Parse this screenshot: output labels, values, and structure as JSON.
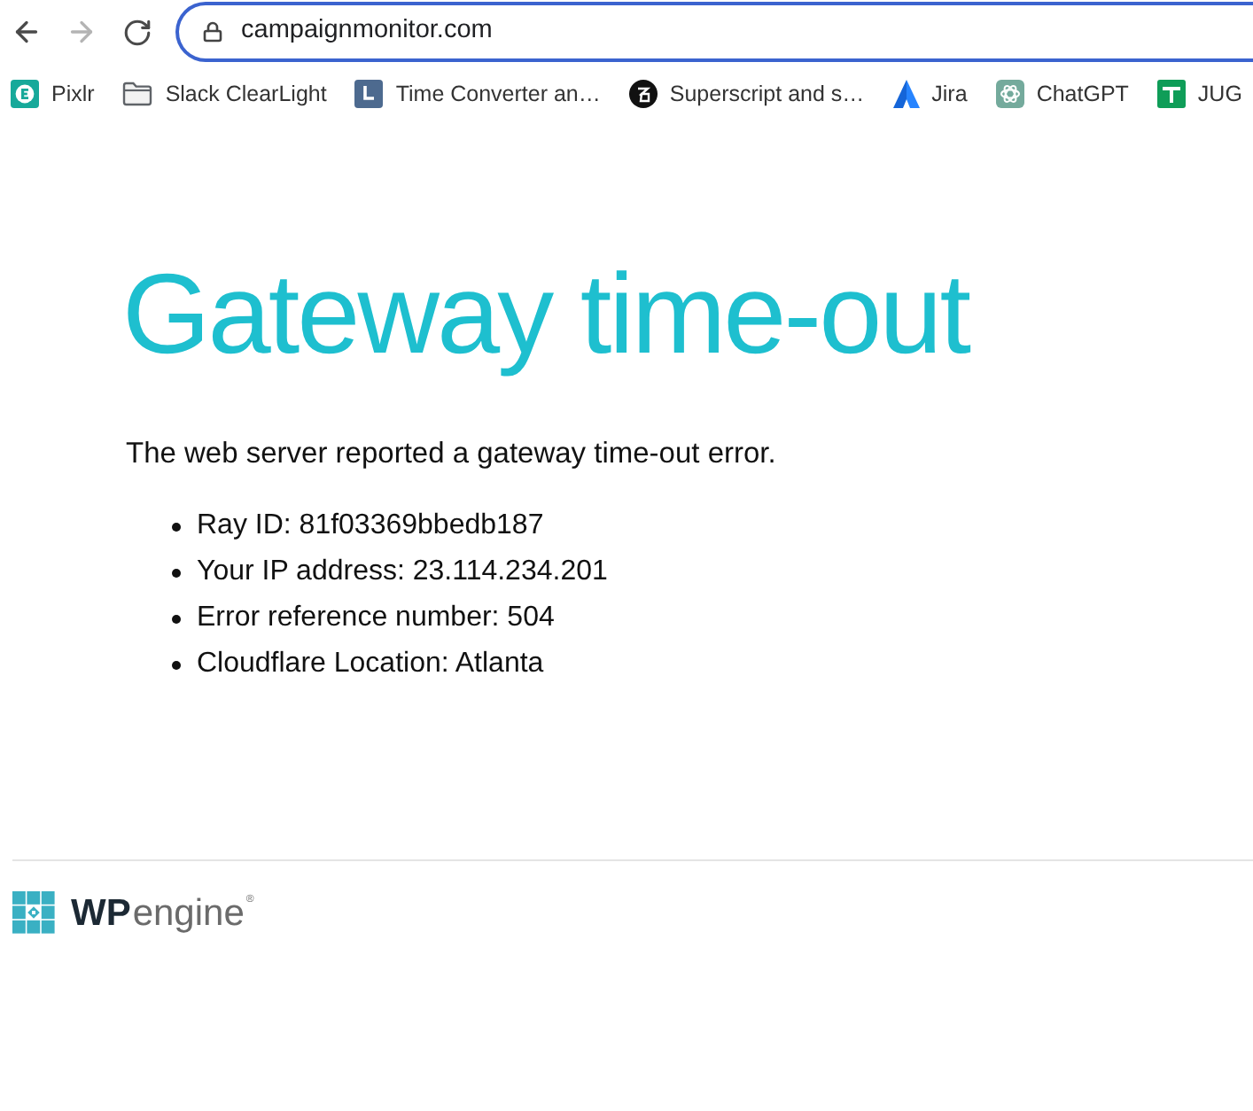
{
  "browser": {
    "nav": [
      {
        "kind": "back",
        "disabled": false
      },
      {
        "kind": "forward",
        "disabled": true
      },
      {
        "kind": "reload",
        "disabled": false
      }
    ],
    "address": "campaignmonitor.com",
    "focused": true
  },
  "bookmarks": [
    {
      "kind": "e-tile",
      "label": "Pixlr"
    },
    {
      "kind": "folder",
      "label": "Slack ClearLight"
    },
    {
      "kind": "clock-tile",
      "label": "Time Converter an…"
    },
    {
      "kind": "dark-disc",
      "label": "Superscript and s…"
    },
    {
      "kind": "peak",
      "label": "Jira"
    },
    {
      "kind": "knot-tile",
      "label": "ChatGPT"
    },
    {
      "kind": "cross-tile",
      "label": "JUG"
    }
  ],
  "page": {
    "title": "Gateway time-out",
    "message": "The web server reported a gateway time-out error.",
    "details": [
      "Ray ID: 81f03369bbedb187",
      "Your IP address: 23.114.234.201",
      "Error reference number: 504",
      "Cloudflare Location: Atlanta"
    ]
  },
  "footer": {
    "wordmark": {
      "strong": "WP",
      "light": "engine",
      "mark": "®"
    }
  }
}
